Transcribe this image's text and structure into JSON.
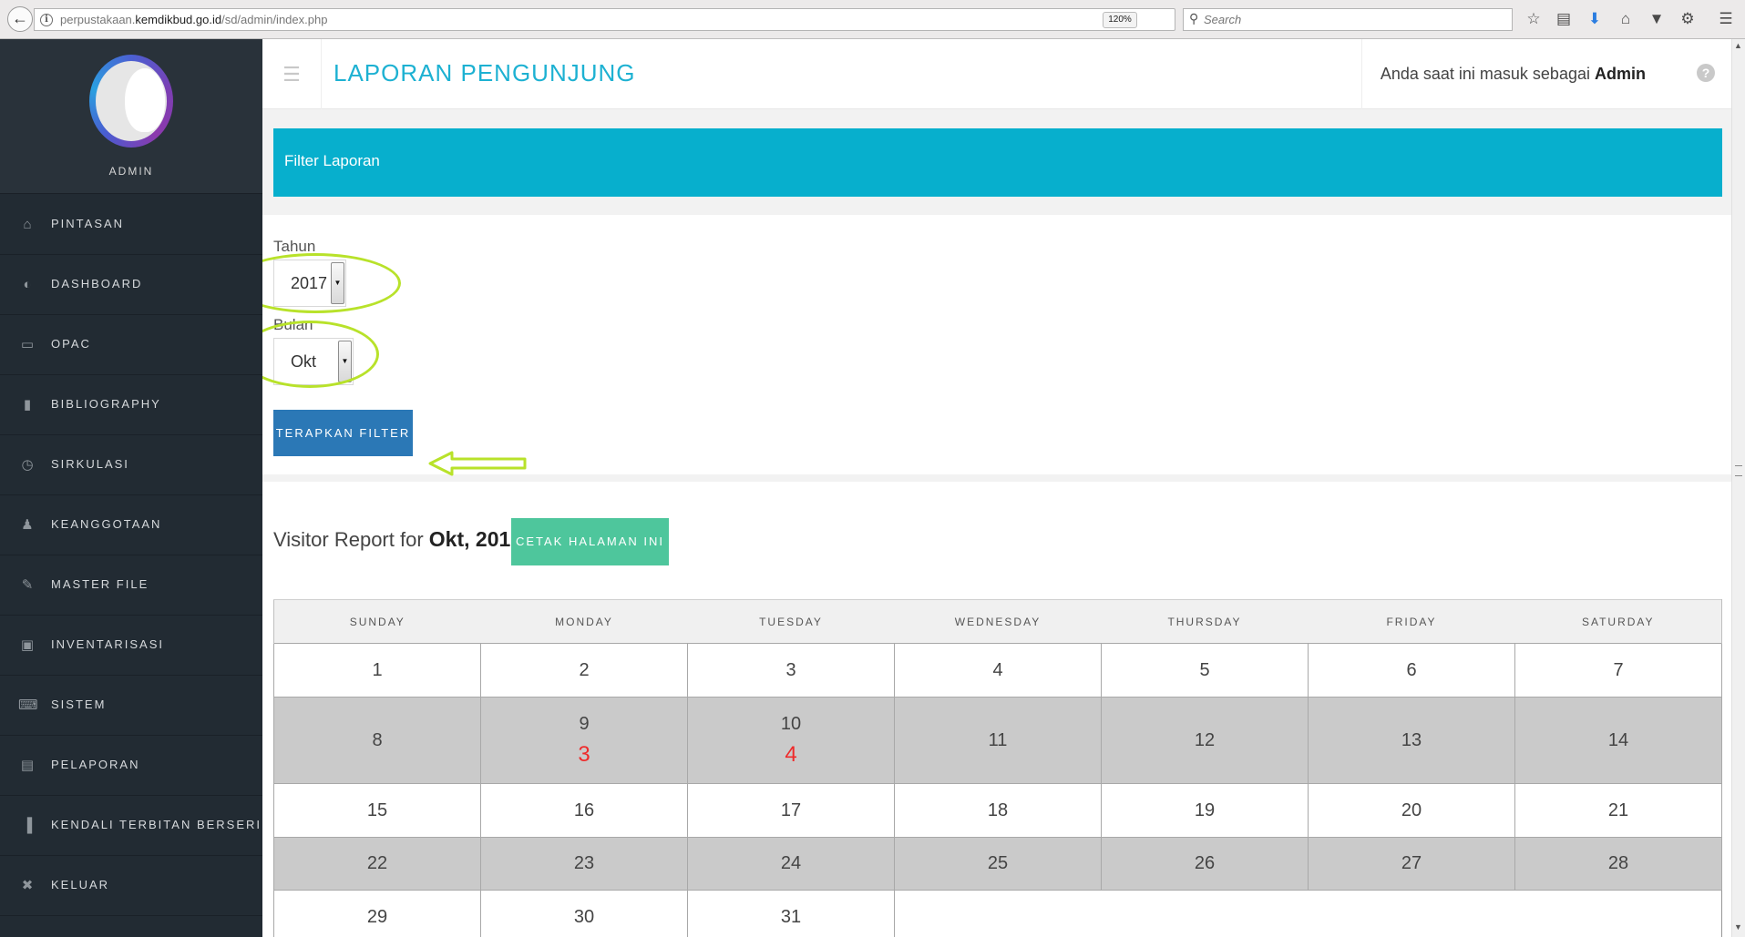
{
  "browser": {
    "url_prefix": "perpustakaan.",
    "url_domain": "kemdikbud.go.id",
    "url_path": "/sd/admin/index.php",
    "zoom": "120%",
    "search_placeholder": "Search"
  },
  "sidebar": {
    "profile_name": "ADMIN",
    "items": [
      {
        "label": "PINTASAN",
        "icon": "home-icon"
      },
      {
        "label": "DASHBOARD",
        "icon": "dashboard-icon"
      },
      {
        "label": "OPAC",
        "icon": "monitor-icon"
      },
      {
        "label": "BIBLIOGRAPHY",
        "icon": "bookmark-icon"
      },
      {
        "label": "SIRKULASI",
        "icon": "clock-icon"
      },
      {
        "label": "KEANGGOTAAN",
        "icon": "user-icon"
      },
      {
        "label": "MASTER FILE",
        "icon": "pencil-icon"
      },
      {
        "label": "INVENTARISASI",
        "icon": "briefcase-icon"
      },
      {
        "label": "SISTEM",
        "icon": "keyboard-icon"
      },
      {
        "label": "PELAPORAN",
        "icon": "file-icon"
      },
      {
        "label": "KENDALI TERBITAN BERSERI",
        "icon": "barcode-icon"
      },
      {
        "label": "KELUAR",
        "icon": "close-icon"
      }
    ]
  },
  "header": {
    "title": "LAPORAN PENGUNJUNG",
    "user_prefix": "Anda saat ini masuk sebagai",
    "user_name": "Admin",
    "help_glyph": "?"
  },
  "filter": {
    "heading": "Filter Laporan",
    "year_label": "Tahun",
    "year_value": "2017",
    "month_label": "Bulan",
    "month_value": "Okt",
    "apply_label": "TERAPKAN FILTER"
  },
  "report": {
    "heading_prefix": "Visitor Report for",
    "month_year": "Okt, 2017",
    "print_label": "CETAK HALAMAN INI",
    "weekdays": [
      "SUNDAY",
      "MONDAY",
      "TUESDAY",
      "WEDNESDAY",
      "THURSDAY",
      "FRIDAY",
      "SATURDAY"
    ],
    "weeks": [
      {
        "style": "light",
        "days": [
          {
            "day": "1"
          },
          {
            "day": "2"
          },
          {
            "day": "3"
          },
          {
            "day": "4"
          },
          {
            "day": "5"
          },
          {
            "day": "6"
          },
          {
            "day": "7"
          }
        ]
      },
      {
        "style": "tall",
        "days": [
          {
            "day": "8"
          },
          {
            "day": "9",
            "count": "3"
          },
          {
            "day": "10",
            "count": "4"
          },
          {
            "day": "11"
          },
          {
            "day": "12"
          },
          {
            "day": "13"
          },
          {
            "day": "14"
          }
        ]
      },
      {
        "style": "light",
        "days": [
          {
            "day": "15"
          },
          {
            "day": "16"
          },
          {
            "day": "17"
          },
          {
            "day": "18"
          },
          {
            "day": "19"
          },
          {
            "day": "20"
          },
          {
            "day": "21"
          }
        ]
      },
      {
        "style": "dark",
        "days": [
          {
            "day": "22"
          },
          {
            "day": "23"
          },
          {
            "day": "24"
          },
          {
            "day": "25"
          },
          {
            "day": "26"
          },
          {
            "day": "27"
          },
          {
            "day": "28"
          }
        ]
      },
      {
        "style": "light",
        "days": [
          {
            "day": "29"
          },
          {
            "day": "30"
          },
          {
            "day": "31"
          }
        ],
        "empty_span": 4
      }
    ]
  },
  "colors": {
    "sidebar_bg": "#222b33",
    "accent_cyan": "#07afcd",
    "apply_button": "#2b78b6",
    "print_button": "#4ec69c",
    "visitor_count": "#ef2b2b",
    "annotation": "#b8e22a"
  }
}
